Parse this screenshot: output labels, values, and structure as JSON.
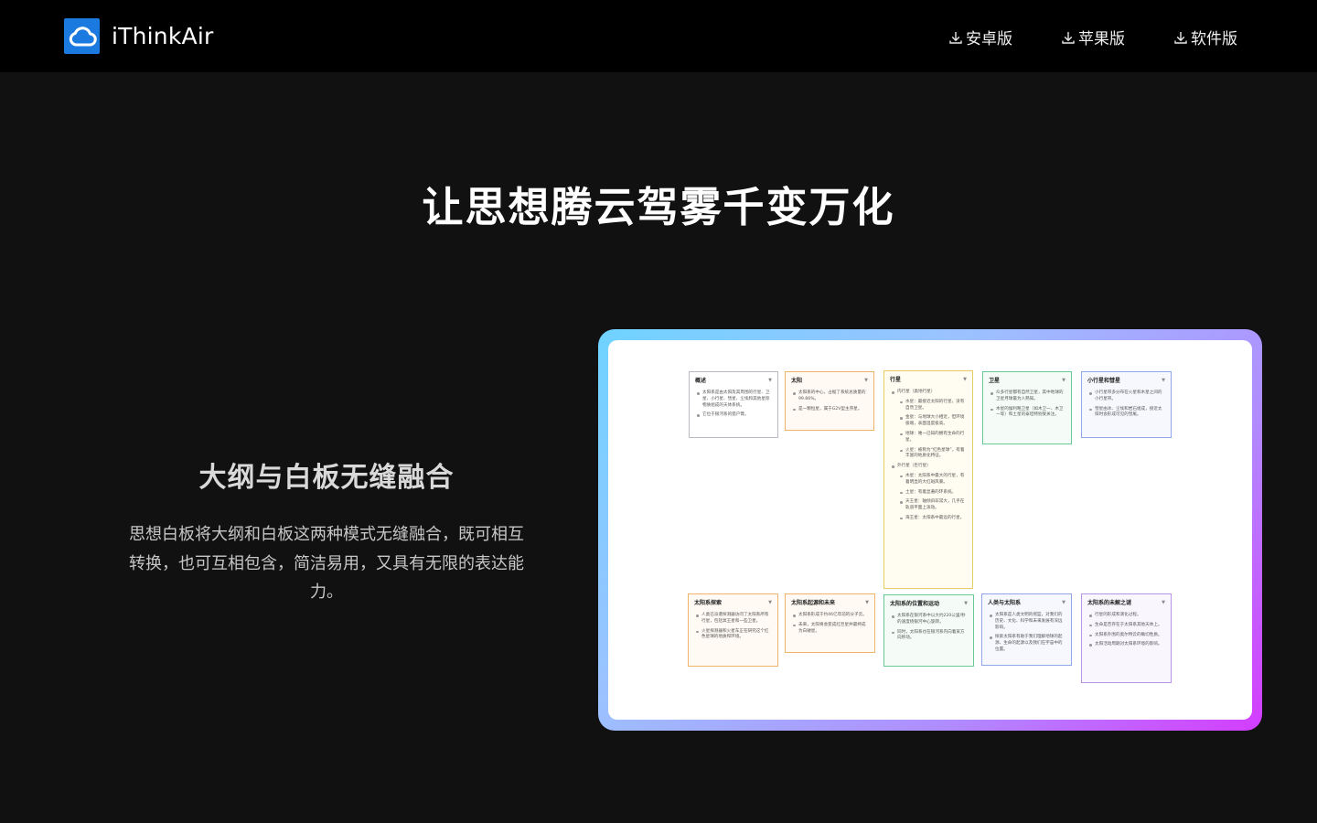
{
  "header": {
    "brand": "iThinkAir",
    "nav": [
      {
        "label": "安卓版",
        "icon": "download-icon"
      },
      {
        "label": "苹果版",
        "icon": "download-icon"
      },
      {
        "label": "软件版",
        "icon": "download-icon"
      }
    ]
  },
  "hero": {
    "title": "让思想腾云驾雾千变万化"
  },
  "feature": {
    "title": "大纲与白板无缝融合",
    "description": "思想白板将大纲和白板这两种模式无缝融合，既可相互转换，也可互相包含，简洁易用，又具有无限的表达能力。"
  },
  "board": {
    "cards": [
      {
        "title": "概述",
        "items": [
          "太阳系是由太阳及其周围的行星、卫星、小行星、彗星、尘埃和其他星际物质组成的天体系统。",
          "它位于银河系的猎户臂。"
        ]
      },
      {
        "title": "太阳",
        "items": [
          "太阳系的中心，占据了系统总质量的99.86%。",
          "是一颗恒星，属于G2V型主序星。"
        ]
      },
      {
        "title": "行星",
        "items": [
          "内行星（类地行星）",
          "水星：最接近太阳的行星，没有自然卫星。",
          "金星：与地球大小相近，但环境极端，表面温度极高。",
          "地球：唯一已知的拥有生命的行星。",
          "火星：被称为“红色星球”，有着丰富的地质化特征。",
          "外行星（巨行星）",
          "木星：太阳系中最大的行星，有着明显的大红斑风暴。",
          "土星：有着显著的环系统。",
          "天王星：轴倾斜非常大，几乎在轨道平面上滚动。",
          "海王星：太阳系中最远的行星。"
        ]
      },
      {
        "title": "卫星",
        "items": [
          "众多行星都有自然卫星，其中地球的卫星月球最为人熟知。",
          "木星的伽利略卫星（如木卫一、木卫一等）和土星的泰坦特别受关注。"
        ]
      },
      {
        "title": "小行星和彗星",
        "items": [
          "小行星带多分布在火星和木星之间的小行星带。",
          "彗星由冰、尘埃和岩石组成，接近太阳时会形成可见的彗尾。"
        ]
      },
      {
        "title": "太阳系探索",
        "items": [
          "人类已派遣探测器访问了太阳系所有行星，包括冥王星和一些卫星。",
          "火星探测器和火星车正在研究这个红色星球的地质和环境。"
        ]
      },
      {
        "title": "太阳系起源和未来",
        "items": [
          "太阳系形成于约46亿年前的分子云。",
          "未来，太阳将会变成红巨星并最终成为白矮星。"
        ]
      },
      {
        "title": "太阳系的位置和运动",
        "items": [
          "太阳系在银河系中以大约220公里/秒的速度绕银河中心旋转。",
          "同时，太阳系也在银河系内向着某方向移动。"
        ]
      },
      {
        "title": "人类与太阳系",
        "items": [
          "太阳系是人类文明的摇篮，对我们的历史、文化、科学和未来发展有深远影响。",
          "探索太阳系有助于我们理解地球的起源、生命的起源以及我们在宇宙中的位置。"
        ]
      },
      {
        "title": "太阳系的未解之谜",
        "items": [
          "行星的形成和演化过程。",
          "生命是否存在于太阳系其他天体上。",
          "太阳系外围的奥尔特云的确切性质。",
          "太阳活动周期对太阳系环境的影响。"
        ]
      }
    ]
  }
}
